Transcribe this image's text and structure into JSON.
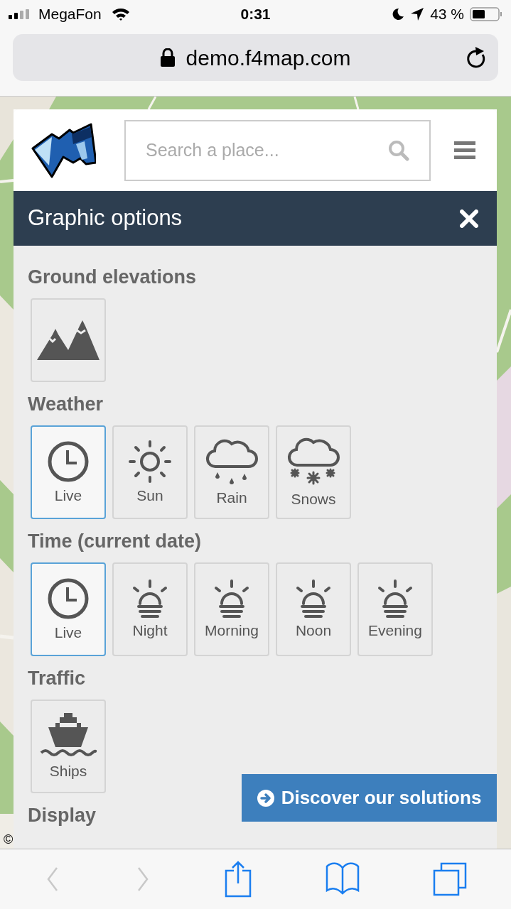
{
  "status_bar": {
    "carrier": "MegaFon",
    "time": "0:31",
    "battery": "43 %"
  },
  "browser": {
    "url": "demo.f4map.com"
  },
  "search": {
    "placeholder": "Search a place..."
  },
  "panel": {
    "title": "Graphic options",
    "sections": [
      {
        "title": "Ground elevations",
        "options": [
          {
            "kind": "mountains",
            "selected": false
          }
        ]
      },
      {
        "title": "Weather",
        "options": [
          {
            "kind": "clock",
            "label": "Live",
            "selected": true
          },
          {
            "kind": "sun",
            "label": "Sun",
            "selected": false
          },
          {
            "kind": "rain",
            "label": "Rain",
            "selected": false
          },
          {
            "kind": "snow",
            "label": "Snows",
            "selected": false
          }
        ]
      },
      {
        "title": "Time (current date)",
        "options": [
          {
            "kind": "clock",
            "label": "Live",
            "selected": true
          },
          {
            "kind": "sunrise",
            "label": "Night",
            "selected": false
          },
          {
            "kind": "sunrise",
            "label": "Morning",
            "selected": false
          },
          {
            "kind": "sunrise",
            "label": "Noon",
            "selected": false
          },
          {
            "kind": "sunrise",
            "label": "Evening",
            "selected": false
          }
        ]
      },
      {
        "title": "Traffic",
        "options": [
          {
            "kind": "ship",
            "label": "Ships",
            "selected": false
          }
        ]
      },
      {
        "title": "Display"
      }
    ]
  },
  "cta": {
    "label": "Discover our solutions"
  },
  "attribution": "©",
  "toolbar": [
    {
      "kind": "back",
      "disabled": true
    },
    {
      "kind": "forward",
      "disabled": true
    },
    {
      "kind": "share",
      "disabled": false
    },
    {
      "kind": "bookmarks",
      "disabled": false
    },
    {
      "kind": "tabs",
      "disabled": false
    }
  ]
}
